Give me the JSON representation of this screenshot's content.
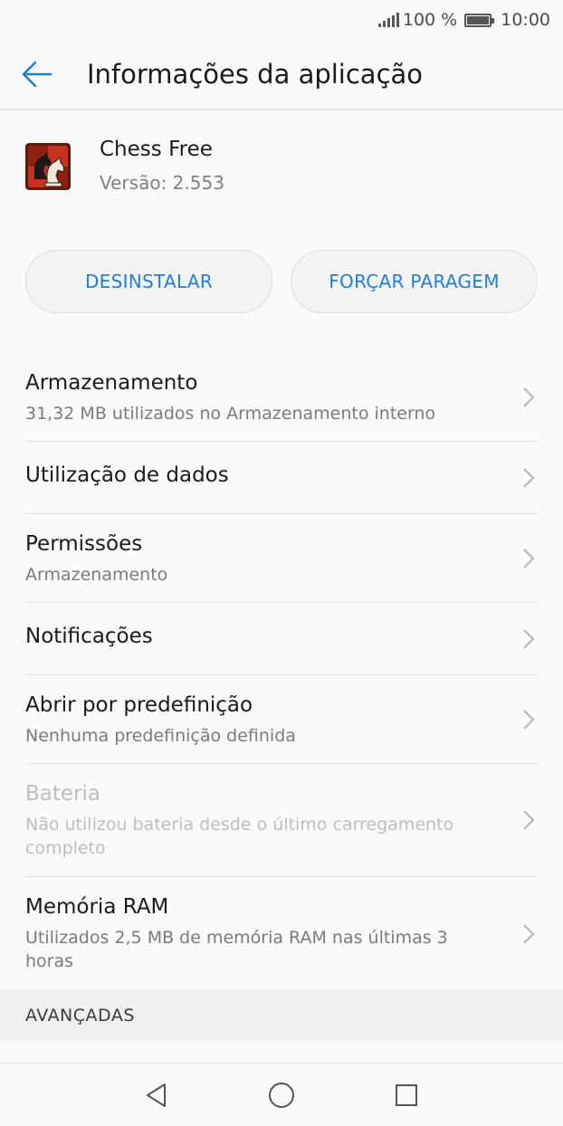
{
  "status_bar": {
    "battery_percent": "100 %",
    "time": "10:00"
  },
  "app_bar": {
    "title": "Informações da aplicação",
    "back_icon": "arrow-left-icon"
  },
  "app": {
    "name": "Chess Free",
    "version": "Versão: 2.553",
    "icon": "chess-knight-app-icon"
  },
  "actions": {
    "uninstall_label": "DESINSTALAR",
    "force_stop_label": "FORÇAR PARAGEM"
  },
  "settings": [
    {
      "title": "Armazenamento",
      "subtitle": "31,32 MB utilizados no Armazenamento interno"
    },
    {
      "title": "Utilização de dados",
      "subtitle": ""
    },
    {
      "title": "Permissões",
      "subtitle": "Armazenamento"
    },
    {
      "title": "Notificações",
      "subtitle": ""
    },
    {
      "title": "Abrir por predefinição",
      "subtitle": "Nenhuma predefinição definida"
    },
    {
      "title": "Bateria",
      "subtitle": "Não utilizou bateria desde o último carregamento completo"
    },
    {
      "title": "Memória RAM",
      "subtitle": "Utilizados 2,5 MB de memória RAM nas últimas 3 horas"
    }
  ],
  "section": {
    "advanced_label": "AVANÇADAS"
  },
  "colors": {
    "accent": "#1e7fd6",
    "background": "#fafafa",
    "disabled_text": "#bdbdbd"
  },
  "nav_bar": {
    "back_icon": "triangle-back-icon",
    "home_icon": "circle-home-icon",
    "recents_icon": "square-recents-icon"
  }
}
